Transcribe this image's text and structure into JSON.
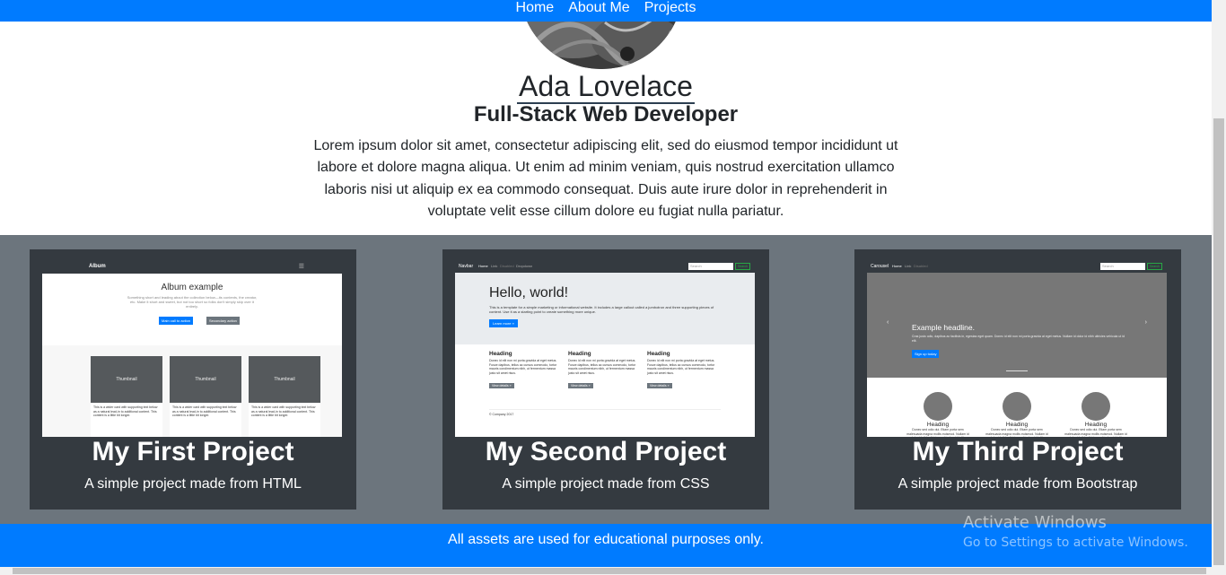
{
  "nav": {
    "items": [
      {
        "label": "Home"
      },
      {
        "label": "About Me"
      },
      {
        "label": "Projects"
      }
    ]
  },
  "hero": {
    "name": "Ada Lovelace",
    "role": "Full-Stack Web Developer",
    "bio": "Lorem ipsum dolor sit amet, consectetur adipiscing elit, sed do eiusmod tempor incididunt ut labore et dolore magna aliqua. Ut enim ad minim veniam, quis nostrud exercitation ullamco laboris nisi ut aliquip ex ea commodo consequat. Duis aute irure dolor in reprehenderit in voluptate velit esse cillum dolore eu fugiat nulla pariatur."
  },
  "projects": [
    {
      "title": "My First Project",
      "description": "A simple project made from HTML",
      "preview": {
        "brand": "Album",
        "heading": "Album example",
        "lead": "Something short and leading about the collection below—its contents, the creator, etc. Make it short and sweet, but not too short so folks don't simply skip over it entirely.",
        "primary_button": "Main call to action",
        "secondary_button": "Secondary action",
        "card_label": "Thumbnail",
        "card_text": "This is a wider card with supporting text below as a natural lead-in to additional content. This content is a little bit longer.",
        "view_button": "View",
        "edit_button": "Edit",
        "time": "9 mins"
      }
    },
    {
      "title": "My Second Project",
      "description": "A simple project made from CSS",
      "preview": {
        "brand": "Navbar",
        "nav_home": "Home",
        "nav_link": "Link",
        "nav_disabled": "Disabled",
        "nav_dropdown": "Dropdown",
        "search_placeholder": "Search",
        "search_button": "Search",
        "heading": "Hello, world!",
        "lead": "This is a template for a simple marketing or informational website. It includes a large callout called a jumbotron and three supporting pieces of content. Use it as a starting point to create something more unique.",
        "learn_button": "Learn more »",
        "col_heading": "Heading",
        "col_text": "Donec id elit non mi porta gravida at eget metus. Fusce dapibus, tellus ac cursus commodo, tortor mauris condimentum nibh, ut fermentum massa justo sit amet risus.",
        "details_button": "View details »",
        "footer": "© Company 2017"
      }
    },
    {
      "title": "My Third Project",
      "description": "A simple project made from Bootstrap",
      "preview": {
        "brand": "Carousel",
        "nav_home": "Home",
        "nav_link": "Link",
        "nav_disabled": "Disabled",
        "search_placeholder": "Search",
        "search_button": "Search",
        "headline": "Example headline.",
        "caption": "Cras justo odio, dapibus ac facilisis in, egestas eget quam. Donec id elit non mi porta gravida at eget metus. Nullam id dolor id nibh ultricies vehicula ut id elit.",
        "signup_button": "Sign up today",
        "col_heading": "Heading",
        "col_text": "Donec sed odio dui. Etiam porta sem malesuada magna mollis euismod. Nullam id dolor id nibh ultricies vehicula ut id elit."
      }
    }
  ],
  "footer": {
    "note": "All assets are used for educational purposes only."
  },
  "watermark": {
    "line1": "Activate Windows",
    "line2": "Go to Settings to activate Windows."
  },
  "colors": {
    "primary": "#007bff",
    "dark": "#343a40",
    "secondary": "#6c757d"
  }
}
